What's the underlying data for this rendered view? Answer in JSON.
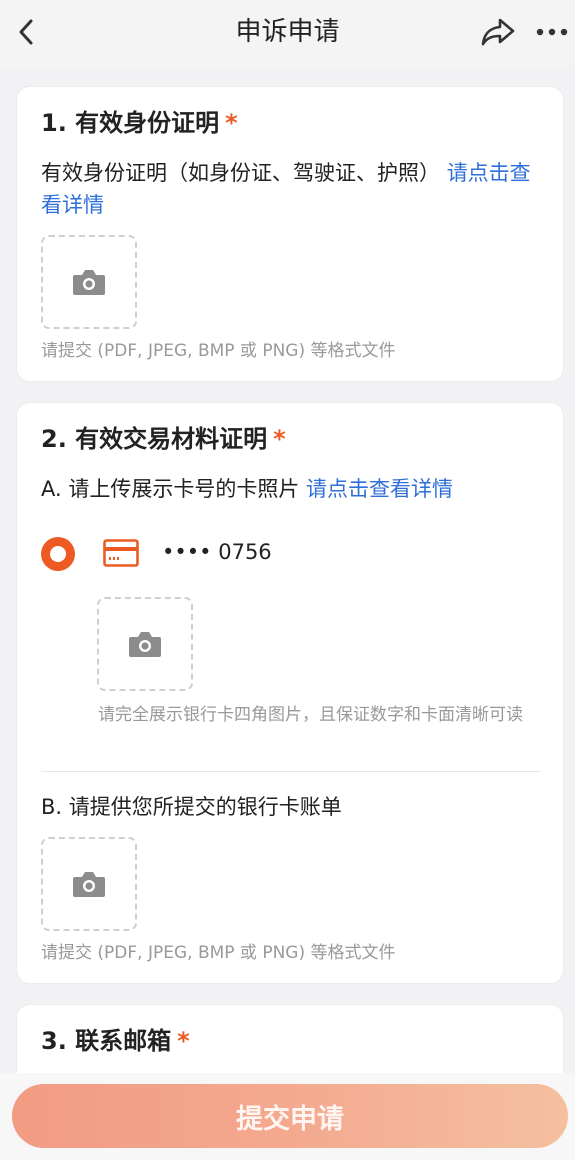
{
  "header": {
    "title": "申诉申请",
    "back_icon": "chevron-left-icon",
    "share_icon": "share-icon",
    "more_icon": "more-dots-icon"
  },
  "section1": {
    "title": "1. 有效身份证明",
    "required_mark": "*",
    "desc_text": "有效身份证明（如身份证、驾驶证、护照）",
    "desc_link": "请点击查看详情",
    "hint": "请提交 (PDF, JPEG, BMP 或 PNG) 等格式文件"
  },
  "section2": {
    "title": "2. 有效交易材料证明",
    "required_mark": "*",
    "partA": {
      "text": "A. 请上传展示卡号的卡照片",
      "link": "请点击查看详情",
      "card_number": "•••• 0756",
      "hint": "请完全展示银行卡四角图片，且保证数字和卡面清晰可读"
    },
    "partB": {
      "text": "B. 请提供您所提交的银行卡账单",
      "hint": "请提交 (PDF, JPEG, BMP 或 PNG) 等格式文件"
    }
  },
  "section3": {
    "title": "3. 联系邮箱",
    "required_mark": "*"
  },
  "submit_label": "提交申请",
  "colors": {
    "accent": "#ee5a24",
    "link": "#2e6fd9",
    "submit_gradient_start": "#f29b83",
    "submit_gradient_end": "#f4c0a0"
  }
}
